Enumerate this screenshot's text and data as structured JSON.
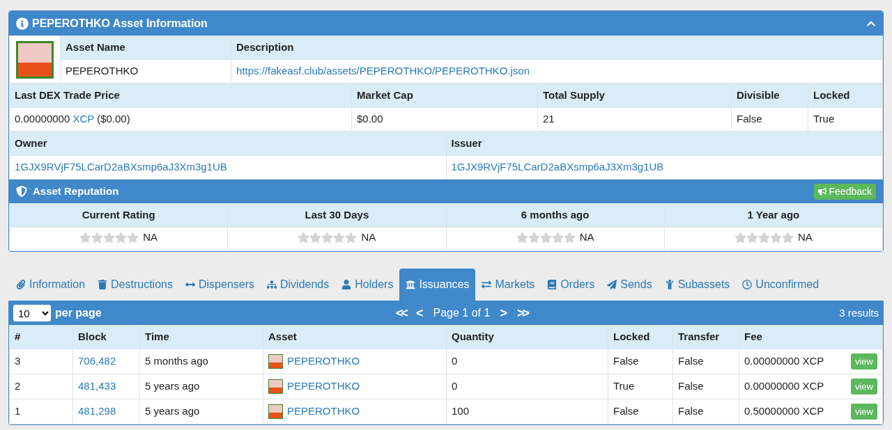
{
  "asset_panel": {
    "title": "PEPEROTHKO Asset Information",
    "name_header": "Asset Name",
    "description_header": "Description",
    "asset_name": "PEPEROTHKO",
    "description_link": "https://fakeasf.club/assets/PEPEROTHKO/PEPEROTHKO.json",
    "stats_columns": [
      "Last DEX Trade Price",
      "Market Cap",
      "Total Supply",
      "Divisible",
      "Locked"
    ],
    "price": {
      "amount": "0.00000000",
      "currency": "XCP",
      "usd": "($0.00)"
    },
    "stats_values": [
      "$0.00",
      "21",
      "False",
      "True"
    ],
    "owner_header": "Owner",
    "issuer_header": "Issuer",
    "owner": "1GJX9RVjF75LCarD2aBXsmp6aJ3Xm3g1UB",
    "issuer": "1GJX9RVjF75LCarD2aBXsmp6aJ3Xm3g1UB"
  },
  "reputation": {
    "title": "Asset Reputation",
    "feedback_button": "Feedback",
    "ratings": [
      {
        "label": "Current Rating",
        "stars": 0,
        "value": "NA"
      },
      {
        "label": "Last 30 Days",
        "stars": 0,
        "value": "NA"
      },
      {
        "label": "6 months ago",
        "stars": 0,
        "value": "NA"
      },
      {
        "label": "1 Year ago",
        "stars": 0,
        "value": "NA"
      }
    ]
  },
  "tabs": [
    {
      "label": "Information",
      "selected": false
    },
    {
      "label": "Destructions",
      "selected": false
    },
    {
      "label": "Dispensers",
      "selected": false
    },
    {
      "label": "Dividends",
      "selected": false
    },
    {
      "label": "Holders",
      "selected": false
    },
    {
      "label": "Issuances",
      "selected": true
    },
    {
      "label": "Markets",
      "selected": false
    },
    {
      "label": "Orders",
      "selected": false
    },
    {
      "label": "Sends",
      "selected": false
    },
    {
      "label": "Subassets",
      "selected": false
    },
    {
      "label": "Unconfirmed",
      "selected": false
    }
  ],
  "issuances": {
    "per_page": "10",
    "per_page_label": "per page",
    "first": "<<",
    "prev": "<",
    "page": "Page 1 of 1",
    "next": ">",
    "last": ">>",
    "results": "3 results",
    "columns": [
      "#",
      "Block",
      "Time",
      "Asset",
      "Quantity",
      "Locked",
      "Transfer",
      "Fee"
    ],
    "rows": [
      {
        "num": "3",
        "block": "706,482",
        "time": "5 months ago",
        "asset": "PEPEROTHKO",
        "quantity": "0",
        "locked": "False",
        "transfer": "False",
        "fee": "0.00000000 XCP",
        "action": "view"
      },
      {
        "num": "2",
        "block": "481,433",
        "time": "5 years ago",
        "asset": "PEPEROTHKO",
        "quantity": "0",
        "locked": "True",
        "transfer": "False",
        "fee": "0.00000000 XCP",
        "action": "view"
      },
      {
        "num": "1",
        "block": "481,298",
        "time": "5 years ago",
        "asset": "PEPEROTHKO",
        "quantity": "100",
        "locked": "False",
        "transfer": "False",
        "fee": "0.50000000 XCP",
        "action": "view"
      }
    ]
  }
}
